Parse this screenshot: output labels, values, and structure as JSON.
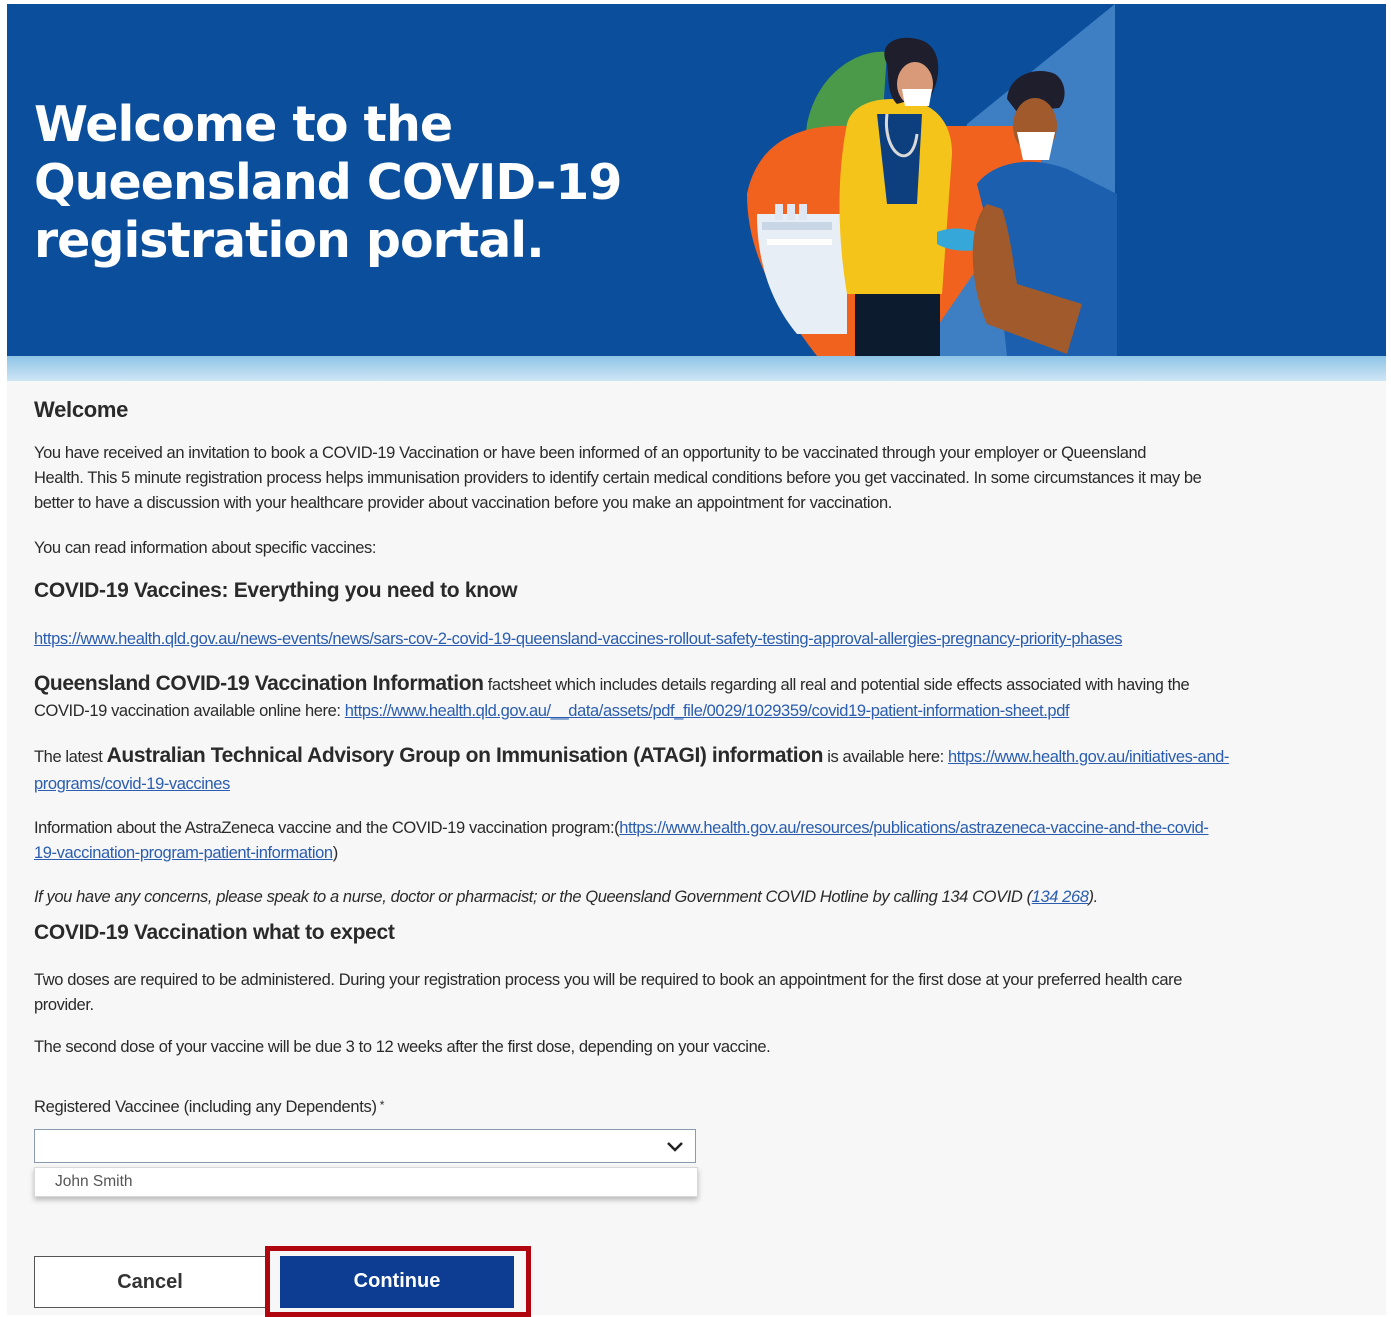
{
  "hero": {
    "title_lines": [
      "Welcome to the",
      "Queensland COVID-19",
      "registration portal."
    ]
  },
  "welcome": {
    "heading": "Welcome",
    "intro_line1": "You have received an invitation to book a COVID-19 Vaccination or have been informed of an opportunity to be vaccinated through your employer or Queensland",
    "intro_line2": "Health.  This 5 minute registration process helps immunisation providers to identify certain medical conditions before you get vaccinated. In some circumstances it may be",
    "intro_line3": "better to have a discussion with your healthcare provider about vaccination before you make an appointment for vaccination.",
    "read_info": "You can read information about specific vaccines:"
  },
  "vaccines_section": {
    "heading": "COVID-19 Vaccines: Everything you need to know",
    "link": "https://www.health.qld.gov.au/news-events/news/sars-cov-2-covid-19-queensland-vaccines-rollout-safety-testing-approval-allergies-pregnancy-priority-phases"
  },
  "qld_info": {
    "bold": "Queensland COVID-19 Vaccination Information",
    "text_a": " factsheet which includes details regarding all real and potential side effects associated with having the",
    "text_b": "COVID-19 vaccination available online here: ",
    "link": "https://www.health.qld.gov.au/__data/assets/pdf_file/0029/1029359/covid19-patient-information-sheet.pdf"
  },
  "atagi": {
    "prefix": "The latest ",
    "bold": "Australian Technical Advisory Group on Immunisation (ATAGI) information",
    "suffix": " is available here: ",
    "link_part1": "https://www.health.gov.au/initiatives-and-",
    "link_part2": "programs/covid-19-vaccines"
  },
  "astrazeneca": {
    "text": "Information about the AstraZeneca vaccine and the COVID-19 vaccination program:(",
    "link_part1": "https://www.health.gov.au/resources/publications/astrazeneca-vaccine-and-the-covid-",
    "link_part2": "19-vaccination-program-patient-information",
    "close": ")"
  },
  "concerns": {
    "text": "If you have any concerns, please speak to a nurse, doctor or pharmacist; or the Queensland Government COVID Hotline by calling 134 COVID (",
    "phone": "134 268",
    "close": ")."
  },
  "expect": {
    "heading": "COVID-19 Vaccination what to expect",
    "doses_line1": "Two doses are required to be administered. During your registration process you will be required to book an appointment for the first dose at your preferred health care",
    "doses_line2": "provider.",
    "second_dose": "The second dose of your vaccine will be due 3 to 12 weeks after the first dose, depending on your vaccine."
  },
  "form": {
    "vaccinee_label": "Registered Vaccinee (including any Dependents)",
    "required_marker": "*",
    "selected_value": "",
    "options": [
      "John Smith"
    ]
  },
  "buttons": {
    "cancel": "Cancel",
    "continue": "Continue"
  },
  "colors": {
    "banner": "#0b4f9c",
    "link": "#2a5db0",
    "primary_button": "#0c3d92",
    "highlight": "#b0060f"
  },
  "icons": {
    "dropdown": "chevron-down-icon",
    "banner_art": "vaccination-illustration"
  }
}
